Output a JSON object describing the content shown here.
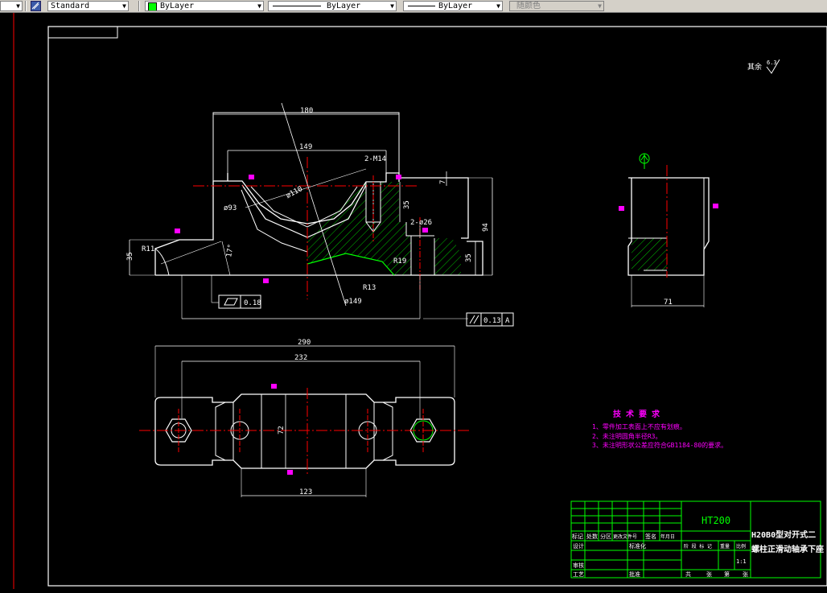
{
  "toolbar": {
    "style_value": "Standard",
    "color_value": "ByLayer",
    "linetype_value": "ByLayer",
    "lineweight_value": "ByLayer",
    "plotstyle_value": "随颜色"
  },
  "colors": {
    "background": "#000000",
    "outline": "#ffffff",
    "centerline": "#ff0000",
    "hatch": "#00c000",
    "annotation": "#ff00ff",
    "titleblock": "#00ff00"
  },
  "drawing": {
    "front_view": {
      "dim_top_width": "180",
      "dim_inner_width": "149",
      "dim_thread": "2-M14",
      "dim_phi93": "ø93",
      "dim_phi110": "ø110",
      "dim_r11": "R11",
      "dim_left_35": "35",
      "dim_angle": "17°",
      "dim_r13": "R13",
      "dim_r19": "R19",
      "dim_phi149": "ø149",
      "dim_phi26": "2-ø26",
      "dim_height_35": "35",
      "dim_right_35": "35",
      "dim_total_94": "94",
      "dim_top_7": "7",
      "flatness_value": "0.18",
      "parallel_value": "0.13",
      "datum": "A"
    },
    "side_view": {
      "dim_width_71": "71"
    },
    "top_view": {
      "dim_290": "290",
      "dim_232": "232",
      "dim_72": "72",
      "dim_123": "123"
    },
    "roughness_note": "其余",
    "roughness_value": "6.3"
  },
  "tech_requirements": {
    "title": "技 术 要 求",
    "items": [
      "1、零件加工表面上不应有划痕。",
      "2、未注明圆角半径R3。",
      "3、未注明形状公差应符合GB1184-80的要求。"
    ]
  },
  "title_block": {
    "material": "HT200",
    "name_line1": "H20B0型对开式二",
    "name_line2": "螺柱正滑动轴承下座",
    "row_labels": [
      "标记",
      "处数",
      "分区",
      "更改文件号",
      "签名",
      "年月日"
    ],
    "left_labels": [
      "设计",
      "审核",
      "工艺"
    ],
    "mid_labels": [
      "标准化",
      "批准"
    ],
    "stage_labels": [
      "阶 段 标 记",
      "重量",
      "比例"
    ],
    "scale": "1:1",
    "sheet_labels": [
      "共",
      "张",
      "第",
      "张"
    ]
  }
}
